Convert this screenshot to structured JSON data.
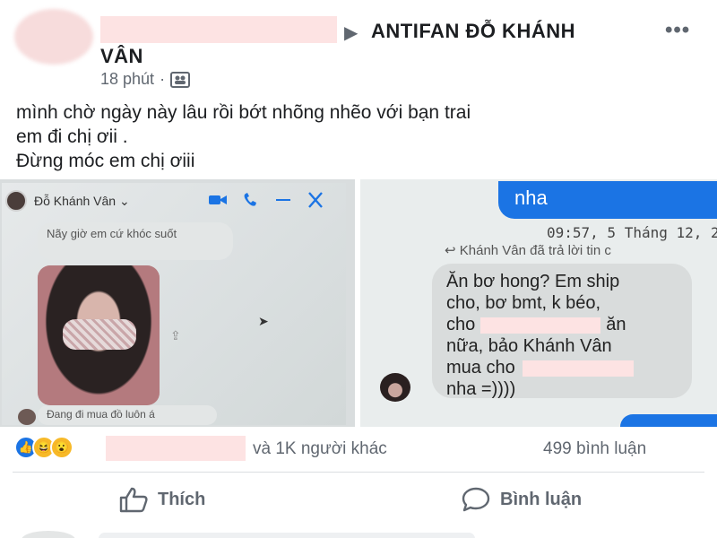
{
  "post": {
    "group_arrow": "▶",
    "group_name_line1": "ANTIFAN ĐỖ KHÁNH",
    "group_name_line2": "VÂN",
    "time": "18 phút",
    "time_separator": "·",
    "more": "•••",
    "caption_lines": [
      "mình chờ ngày này lâu rồi bớt nhõng nhẽo với bạn trai",
      "em đi chị ơii .",
      "Đừng móc em chị ơiii"
    ]
  },
  "left_screenshot": {
    "chat_name": "Đỗ Khánh Vân",
    "chevron": "⌄",
    "bubble_top": "Nãy giờ em cứ khóc suốt",
    "bubble_bottom": "Đang đi mua đồ luôn á",
    "window_icons": [
      "video-icon",
      "phone-icon",
      "minimize-icon",
      "close-icon"
    ]
  },
  "right_screenshot": {
    "blue_bubble": "nha",
    "timestamp": "09:57, 5 Tháng 12, 2",
    "reply_note": "Khánh Vân đã trả lời tin c",
    "message_lines": [
      "Ăn bơ hong? Em ship",
      "cho, bơ bmt, k béo,",
      "cho",
      "ăn",
      "nữa, bảo Khánh Vân",
      "mua cho",
      "nha =))))"
    ]
  },
  "footer": {
    "reactions": [
      "like-icon",
      "haha-icon",
      "wow-icon"
    ],
    "others_text": "và 1K người khác",
    "comments_text": "499 bình luận",
    "like_label": "Thích",
    "comment_label": "Bình luận"
  },
  "colors": {
    "facebook_blue": "#1b74e4",
    "redaction_pink": "#fde3e3",
    "secondary_text": "#606770"
  }
}
